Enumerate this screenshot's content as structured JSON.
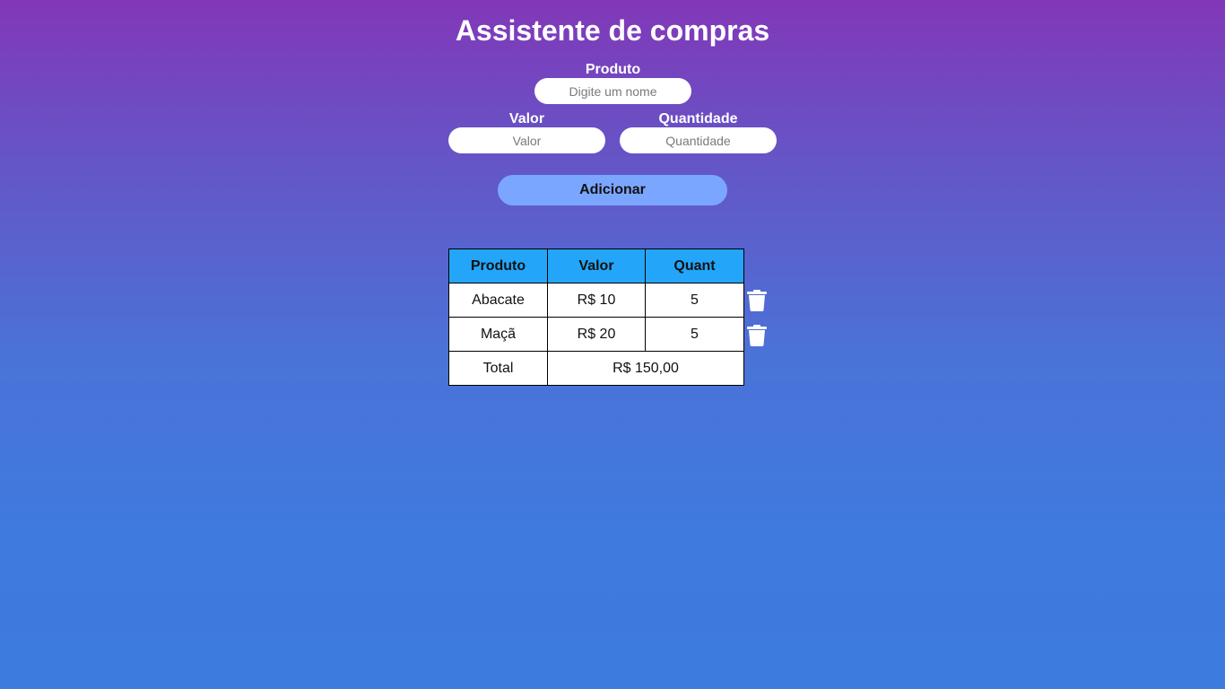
{
  "app": {
    "title": "Assistente de compras"
  },
  "form": {
    "produto": {
      "label": "Produto",
      "placeholder": "Digite um nome",
      "value": ""
    },
    "valor": {
      "label": "Valor",
      "placeholder": "Valor",
      "value": ""
    },
    "quantidade": {
      "label": "Quantidade",
      "placeholder": "Quantidade",
      "value": ""
    },
    "add_label": "Adicionar"
  },
  "table": {
    "headers": [
      "Produto",
      "Valor",
      "Quant"
    ],
    "rows": [
      {
        "produto": "Abacate",
        "valor": "R$ 10",
        "quant": "5",
        "delete_icon": "trash-icon"
      },
      {
        "produto": "Maçã",
        "valor": "R$ 20",
        "quant": "5",
        "delete_icon": "trash-icon"
      }
    ],
    "total_label": "Total",
    "total_value": "R$ 150,00"
  },
  "colors": {
    "gradient_top": "#8237b8",
    "gradient_bottom": "#3e7bdf",
    "button": "#7aa6ff",
    "table_header": "#23a6f9"
  }
}
